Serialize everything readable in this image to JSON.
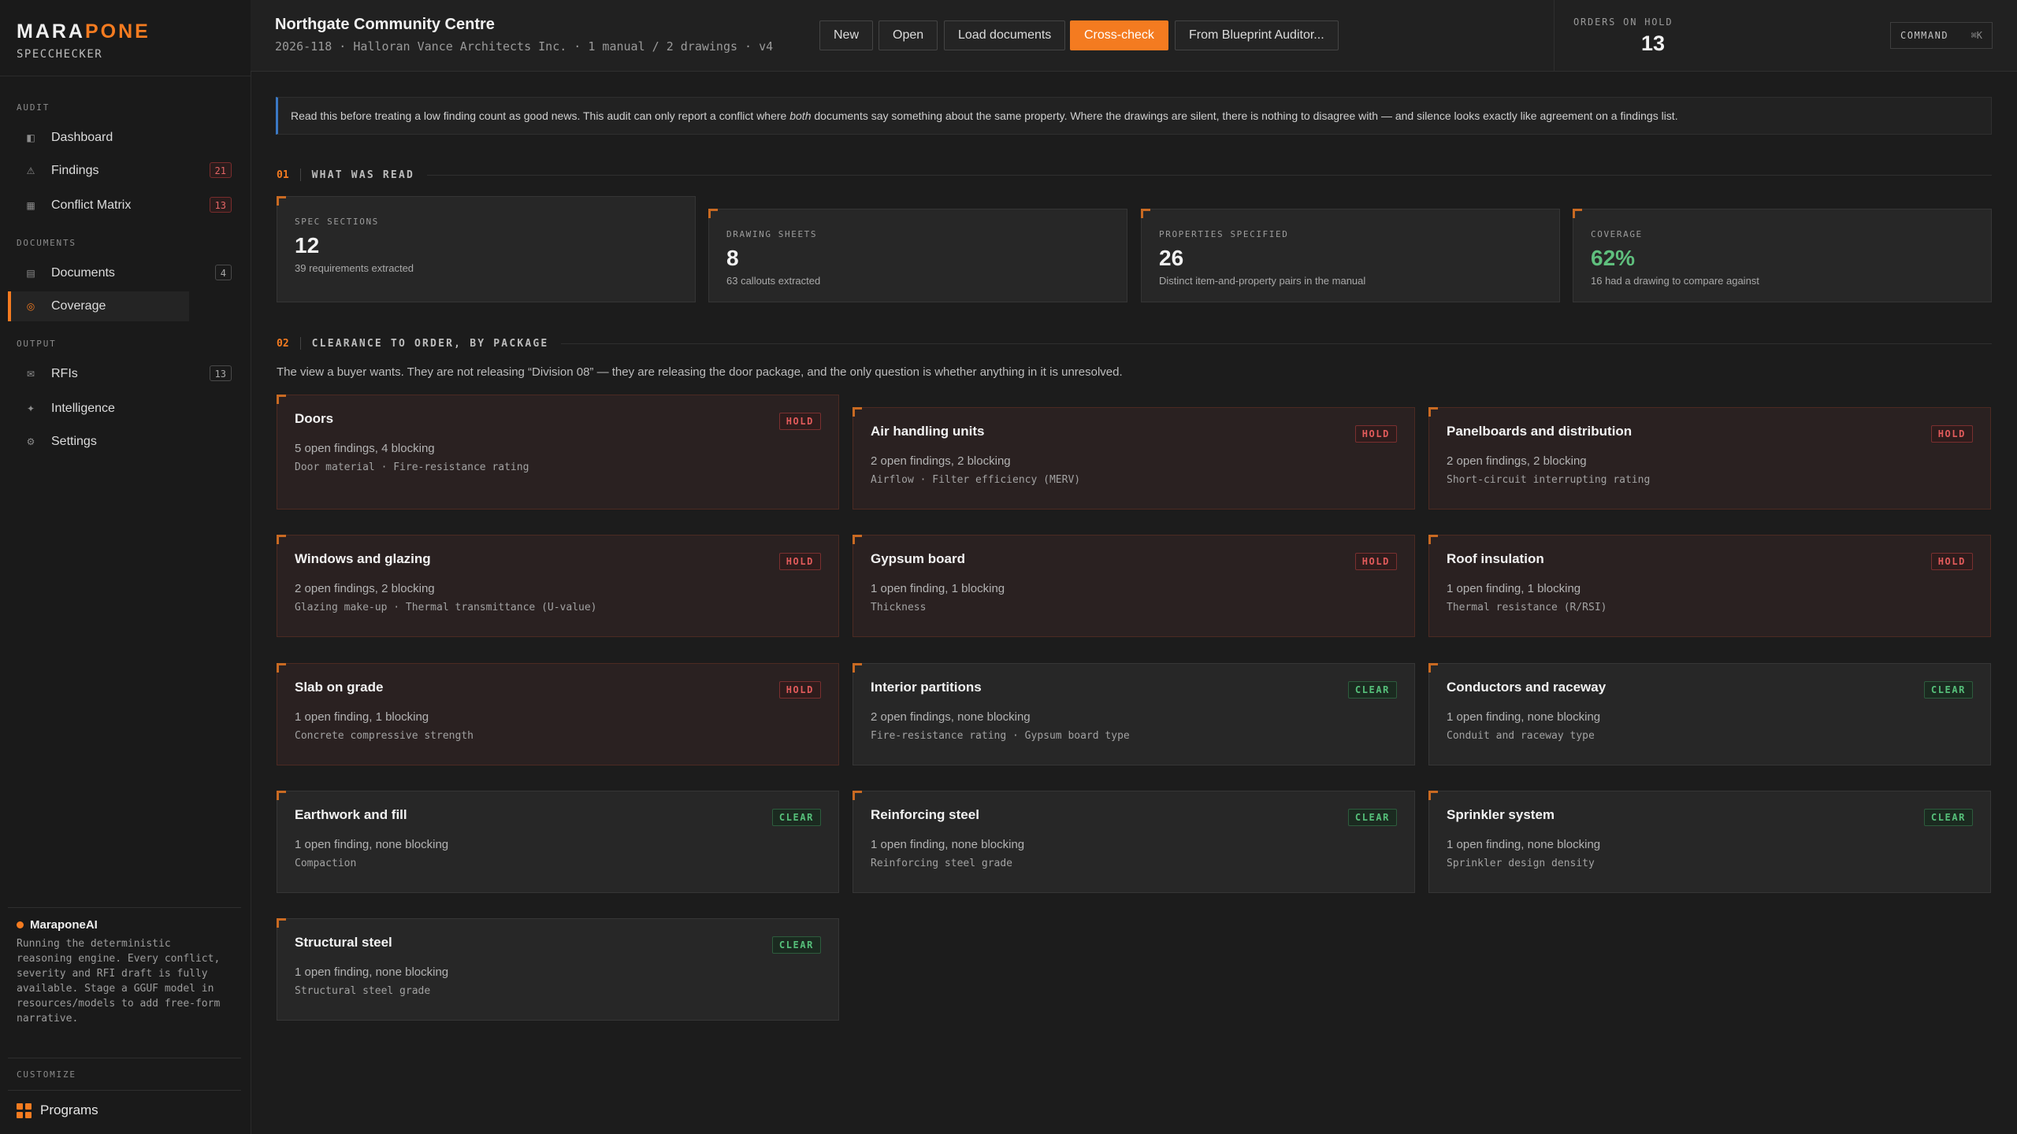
{
  "brand": {
    "name_part1": "MARA",
    "name_part2": "PONE",
    "subtitle": "SPECCHECKER"
  },
  "sidebar": {
    "sections": [
      {
        "label": "AUDIT"
      },
      {
        "label": "DOCUMENTS"
      },
      {
        "label": "OUTPUT"
      }
    ],
    "items": [
      {
        "label": "Dashboard",
        "icon": "dashboard-icon",
        "badge": ""
      },
      {
        "label": "Findings",
        "icon": "warning-icon",
        "badge": "21"
      },
      {
        "label": "Conflict Matrix",
        "icon": "matrix-icon",
        "badge": "13"
      },
      {
        "label": "Documents",
        "icon": "document-icon",
        "badge": "4"
      },
      {
        "label": "Coverage",
        "icon": "target-icon",
        "badge": ""
      },
      {
        "label": "RFIs",
        "icon": "mail-icon",
        "badge": "13"
      },
      {
        "label": "Intelligence",
        "icon": "sparkle-icon",
        "badge": ""
      },
      {
        "label": "Settings",
        "icon": "gear-icon",
        "badge": ""
      }
    ],
    "ai": {
      "title": "MaraponeAI",
      "text": "Running the deterministic reasoning engine. Every conflict, severity and RFI draft is fully available. Stage a GGUF model in resources/models to add free-form narrative."
    },
    "customize_label": "CUSTOMIZE",
    "programs_label": "Programs"
  },
  "header": {
    "title": "Northgate Community Centre",
    "subtitle": "2026-118 · Halloran Vance Architects Inc. · 1 manual / 2 drawings · v4",
    "buttons": [
      "New",
      "Open",
      "Load documents",
      "Cross-check",
      "From Blueprint Auditor..."
    ],
    "orders_on_hold_label": "ORDERS ON HOLD",
    "orders_on_hold_value": "13",
    "command_label": "COMMAND",
    "command_shortcut": "⌘K"
  },
  "notice": {
    "before": "Read this before treating a low finding count as good news. This audit can only report a conflict where ",
    "emphasis": "both",
    "after": " documents say something about the same property. Where the drawings are silent, there is nothing to disagree with — and silence looks exactly like agreement on a findings list."
  },
  "section1": {
    "number": "01",
    "title": "WHAT WAS READ"
  },
  "stats": [
    {
      "label": "SPEC SECTIONS",
      "value": "12",
      "note": "39 requirements extracted"
    },
    {
      "label": "DRAWING SHEETS",
      "value": "8",
      "note": "63 callouts extracted"
    },
    {
      "label": "PROPERTIES SPECIFIED",
      "value": "26",
      "note": "Distinct item-and-property pairs in the manual"
    },
    {
      "label": "COVERAGE",
      "value": "62%",
      "note": "16 had a drawing to compare against"
    }
  ],
  "section2": {
    "number": "02",
    "title": "CLEARANCE TO ORDER, BY PACKAGE",
    "intro": "The view a buyer wants. They are not releasing “Division 08” — they are releasing the door package, and the only question is whether anything in it is unresolved."
  },
  "packages": [
    {
      "name": "Doors",
      "status": "HOLD",
      "count": "5 open findings, 4 blocking",
      "properties": "Door material · Fire-resistance rating"
    },
    {
      "name": "Air handling units",
      "status": "HOLD",
      "count": "2 open findings, 2 blocking",
      "properties": "Airflow · Filter efficiency (MERV)"
    },
    {
      "name": "Panelboards and distribution",
      "status": "HOLD",
      "count": "2 open findings, 2 blocking",
      "properties": "Short-circuit interrupting rating"
    },
    {
      "name": "Windows and glazing",
      "status": "HOLD",
      "count": "2 open findings, 2 blocking",
      "properties": "Glazing make-up · Thermal transmittance (U-value)"
    },
    {
      "name": "Gypsum board",
      "status": "HOLD",
      "count": "1 open finding, 1 blocking",
      "properties": "Thickness"
    },
    {
      "name": "Roof insulation",
      "status": "HOLD",
      "count": "1 open finding, 1 blocking",
      "properties": "Thermal resistance (R/RSI)"
    },
    {
      "name": "Slab on grade",
      "status": "HOLD",
      "count": "1 open finding, 1 blocking",
      "properties": "Concrete compressive strength"
    },
    {
      "name": "Interior partitions",
      "status": "CLEAR",
      "count": "2 open findings, none blocking",
      "properties": "Fire-resistance rating · Gypsum board type"
    },
    {
      "name": "Conductors and raceway",
      "status": "CLEAR",
      "count": "1 open finding, none blocking",
      "properties": "Conduit and raceway type"
    },
    {
      "name": "Earthwork and fill",
      "status": "CLEAR",
      "count": "1 open finding, none blocking",
      "properties": "Compaction"
    },
    {
      "name": "Reinforcing steel",
      "status": "CLEAR",
      "count": "1 open finding, none blocking",
      "properties": "Reinforcing steel grade"
    },
    {
      "name": "Sprinkler system",
      "status": "CLEAR",
      "count": "1 open finding, none blocking",
      "properties": "Sprinkler design density"
    },
    {
      "name": "Structural steel",
      "status": "CLEAR",
      "count": "1 open finding, none blocking",
      "properties": "Structural steel grade"
    }
  ],
  "colors": {
    "accent": "#f47b20",
    "hold": "#e25b5b",
    "clear": "#56c07a",
    "info_bar": "#3b78c4"
  }
}
